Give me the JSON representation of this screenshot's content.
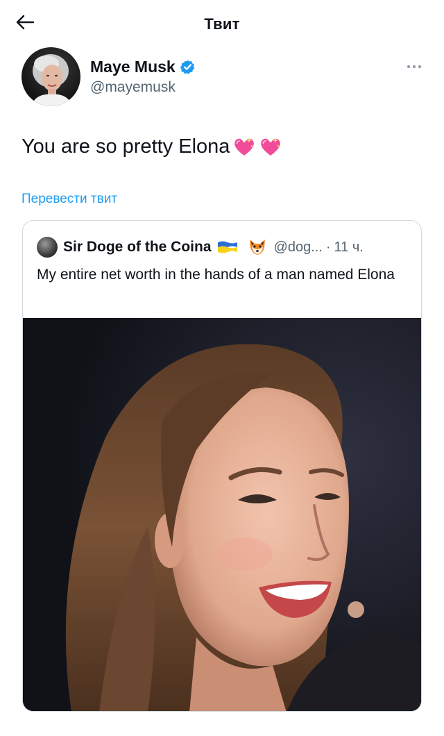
{
  "header": {
    "title": "Твит",
    "back_icon": "arrow-left-icon"
  },
  "author": {
    "name": "Maye Musk",
    "handle": "@mayemusk",
    "verified": true,
    "verified_color": "#1d9bf0"
  },
  "tweet": {
    "text": "You are so pretty Elona",
    "emojis": [
      "sparkling-heart-icon",
      "sparkling-heart-icon"
    ],
    "translate_label": "Перевести твит",
    "more_icon": "more-dots-icon"
  },
  "quoted": {
    "name": "Sir Doge of the Coina",
    "name_icons": [
      "ukraine-flag-icon",
      "fox-icon"
    ],
    "handle": "@dog...",
    "separator": "·",
    "time": "11 ч.",
    "text": "My entire net worth in the hands of a man named Elona",
    "media": "photo-of-smiling-woman"
  },
  "colors": {
    "text_primary": "#0f1419",
    "text_secondary": "#536471",
    "link": "#1d9bf0",
    "border": "#cfd9de"
  }
}
